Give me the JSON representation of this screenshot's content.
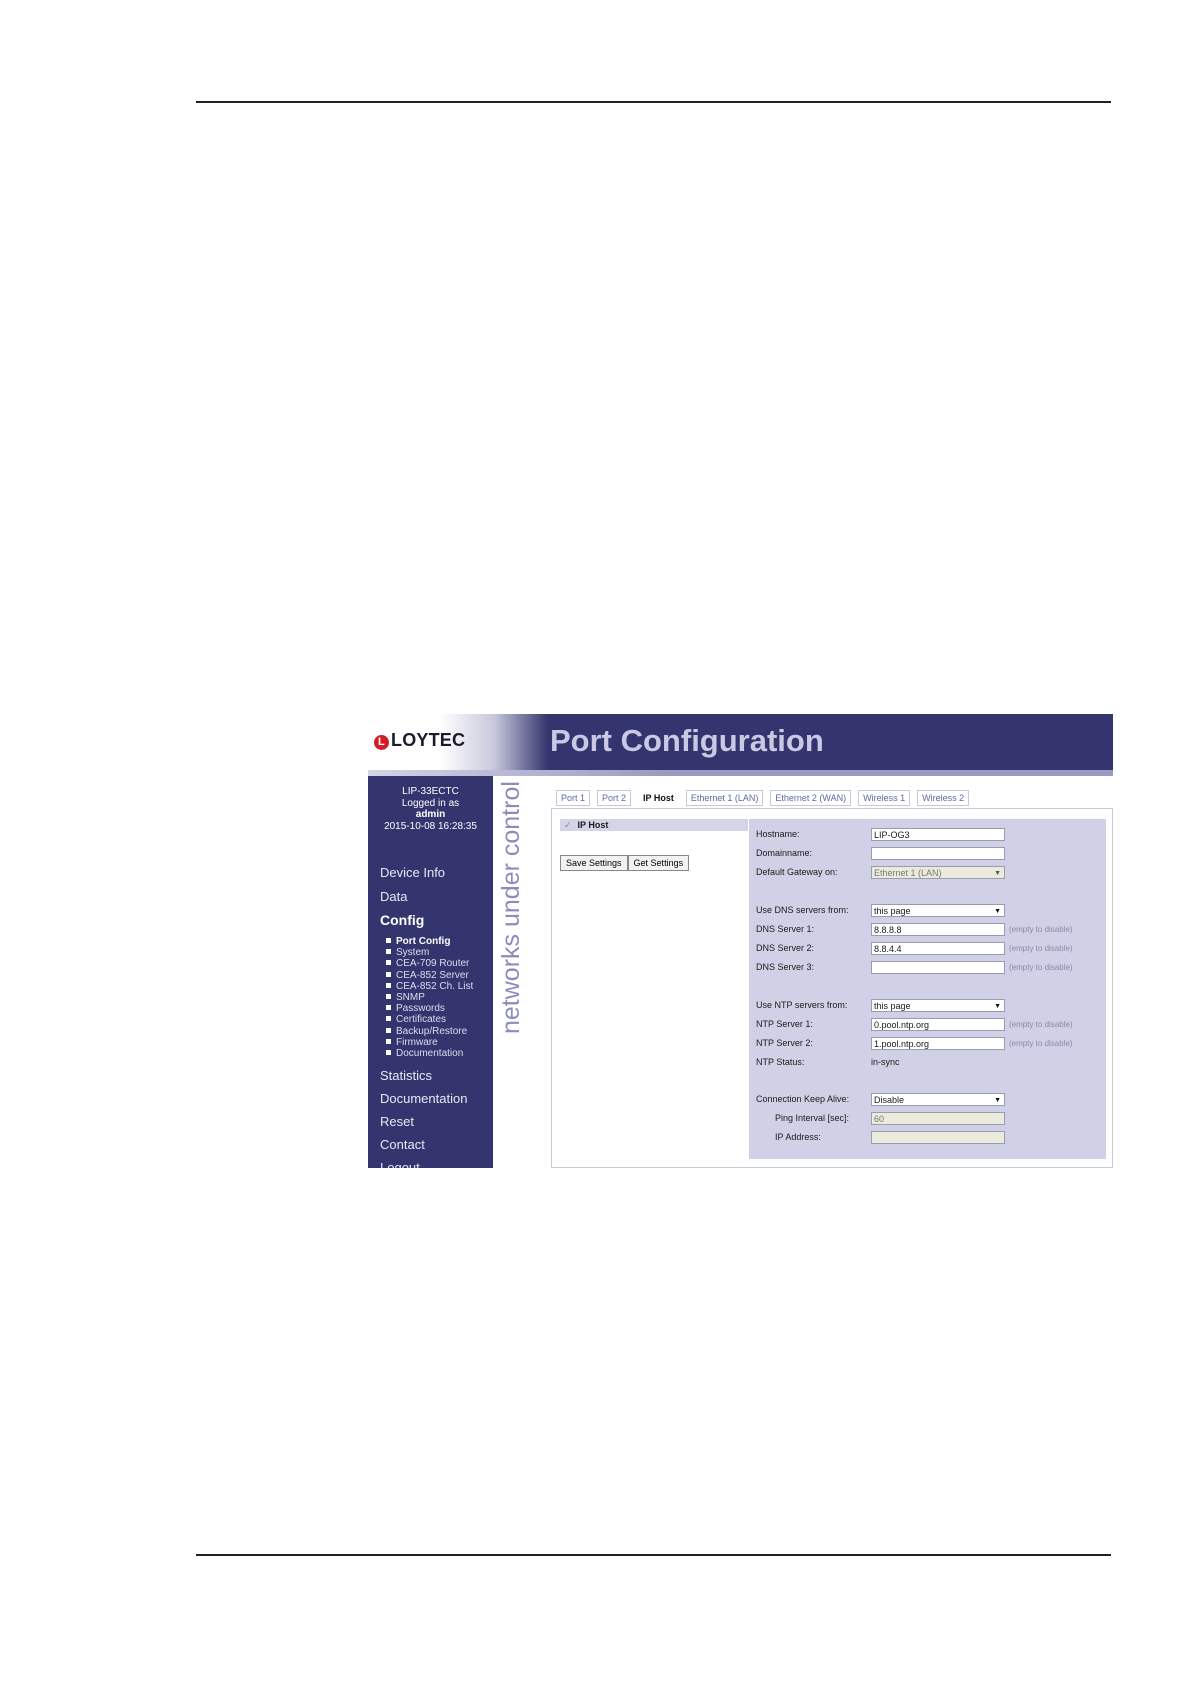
{
  "header": {
    "logo_text": "LOYTEC",
    "logo_mark": "L",
    "page_title": "Port Configuration"
  },
  "sidebar": {
    "device": "LIP-33ECTC",
    "logged_in_as": "Logged in as",
    "user": "admin",
    "datetime": "2015-10-08 16:28:35",
    "menu": [
      "Device Info",
      "Data",
      "Config"
    ],
    "config_submenu": [
      "Port Config",
      "System",
      "CEA-709 Router",
      "CEA-852 Server",
      "CEA-852 Ch. List",
      "SNMP",
      "Passwords",
      "Certificates",
      "Backup/Restore",
      "Firmware",
      "Documentation"
    ],
    "menu_after": [
      "Statistics",
      "Documentation",
      "Reset",
      "Contact",
      "Logout"
    ],
    "slogan": "networks under control"
  },
  "tabs": [
    "Port 1",
    "Port 2",
    "IP Host",
    "Ethernet 1 (LAN)",
    "Ethernet 2 (WAN)",
    "Wireless 1",
    "Wireless 2"
  ],
  "section": {
    "title": "IP Host",
    "check": "✓"
  },
  "buttons": {
    "save": "Save Settings",
    "get": "Get Settings"
  },
  "form": {
    "hostname": {
      "label": "Hostname:",
      "value": "LIP-OG3"
    },
    "domainname": {
      "label": "Domainname:",
      "value": ""
    },
    "default_gateway": {
      "label": "Default Gateway on:",
      "value": "Ethernet 1 (LAN)"
    },
    "dns_from": {
      "label": "Use DNS servers from:",
      "value": "this page"
    },
    "dns1": {
      "label": "DNS Server 1:",
      "value": "8.8.8.8",
      "hint": "(empty to disable)"
    },
    "dns2": {
      "label": "DNS Server 2:",
      "value": "8.8.4.4",
      "hint": "(empty to disable)"
    },
    "dns3": {
      "label": "DNS Server 3:",
      "value": "",
      "hint": "(empty to disable)"
    },
    "ntp_from": {
      "label": "Use NTP servers from:",
      "value": "this page"
    },
    "ntp1": {
      "label": "NTP Server 1:",
      "value": "0.pool.ntp.org",
      "hint": "(empty to disable)"
    },
    "ntp2": {
      "label": "NTP Server 2:",
      "value": "1.pool.ntp.org",
      "hint": "(empty to disable)"
    },
    "ntp_status": {
      "label": "NTP Status:",
      "value": "in-sync"
    },
    "keep_alive": {
      "label": "Connection Keep Alive:",
      "value": "Disable"
    },
    "ping_interval": {
      "label": "Ping Interval [sec]:",
      "value": "60"
    },
    "ip_address": {
      "label": "IP Address:",
      "value": ""
    }
  }
}
